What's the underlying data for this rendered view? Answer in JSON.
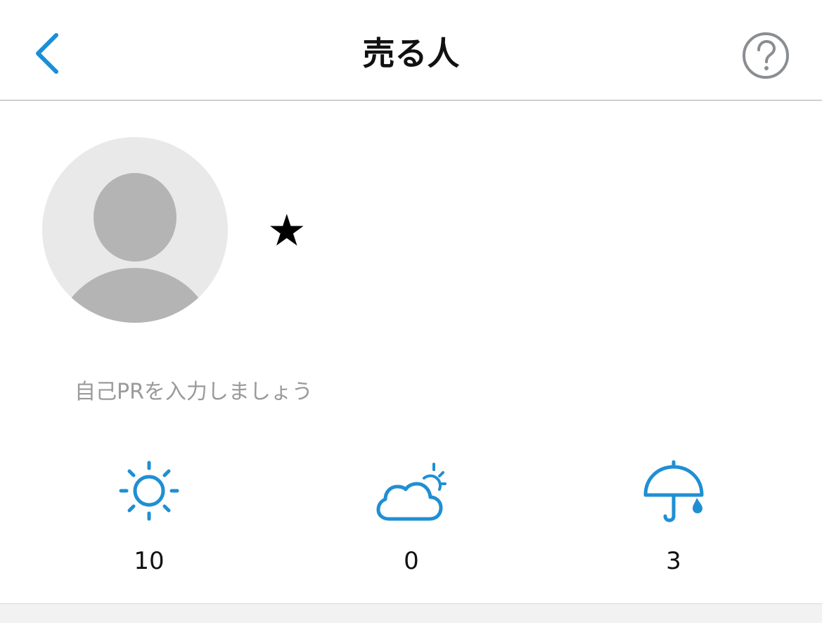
{
  "header": {
    "title": "売る人"
  },
  "profile": {
    "rating": "★",
    "pr_placeholder": "自己PRを入力しましょう"
  },
  "evaluations": [
    {
      "icon": "sun-icon",
      "count": "10"
    },
    {
      "icon": "cloud-sun-icon",
      "count": "0"
    },
    {
      "icon": "umbrella-icon",
      "count": "3"
    }
  ],
  "colors": {
    "accent": "#1a8fd6",
    "icon_blue": "#1f8fd3",
    "help_gray": "#8a8d91",
    "avatar_bg": "#e9e9e9",
    "avatar_fg": "#b4b4b4"
  }
}
